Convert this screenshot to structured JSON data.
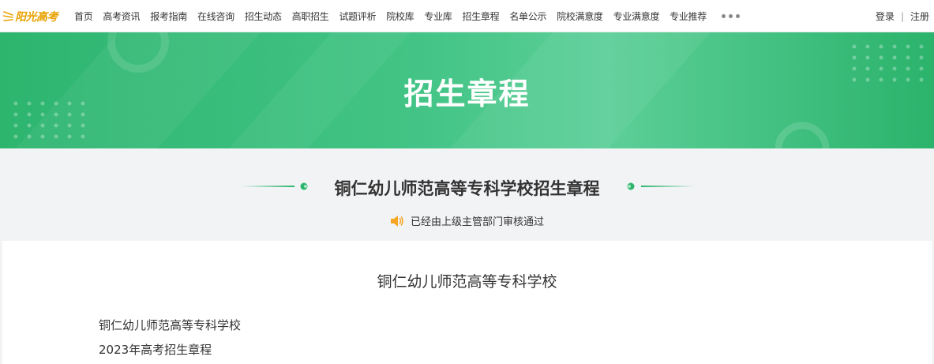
{
  "brand": {
    "logo_text": "阳光高考",
    "logo_color": "#e8a200"
  },
  "nav": {
    "items": [
      "首页",
      "高考资讯",
      "报考指南",
      "在线咨询",
      "招生动态",
      "高职招生",
      "试题评析",
      "院校库",
      "专业库",
      "招生章程",
      "名单公示",
      "院校满意度",
      "专业满意度",
      "专业推荐"
    ],
    "more_icon": "more-dots-icon"
  },
  "auth": {
    "login": "登录",
    "separator": "|",
    "register": "注册"
  },
  "banner": {
    "title": "招生章程",
    "colors": [
      "#2db56e",
      "#5ccf98"
    ]
  },
  "heading": {
    "school_title": "铜仁幼儿师范高等专科学校招生章程",
    "audit_icon": "speaker-icon",
    "audit_text": "已经由上级主管部门审核通过",
    "accent_color": "#2db56e",
    "audit_icon_color": "#f5a623"
  },
  "content": {
    "title": "铜仁幼儿师范高等专科学校",
    "lines": [
      "铜仁幼儿师范高等专科学校",
      "2023年高考招生章程"
    ]
  }
}
